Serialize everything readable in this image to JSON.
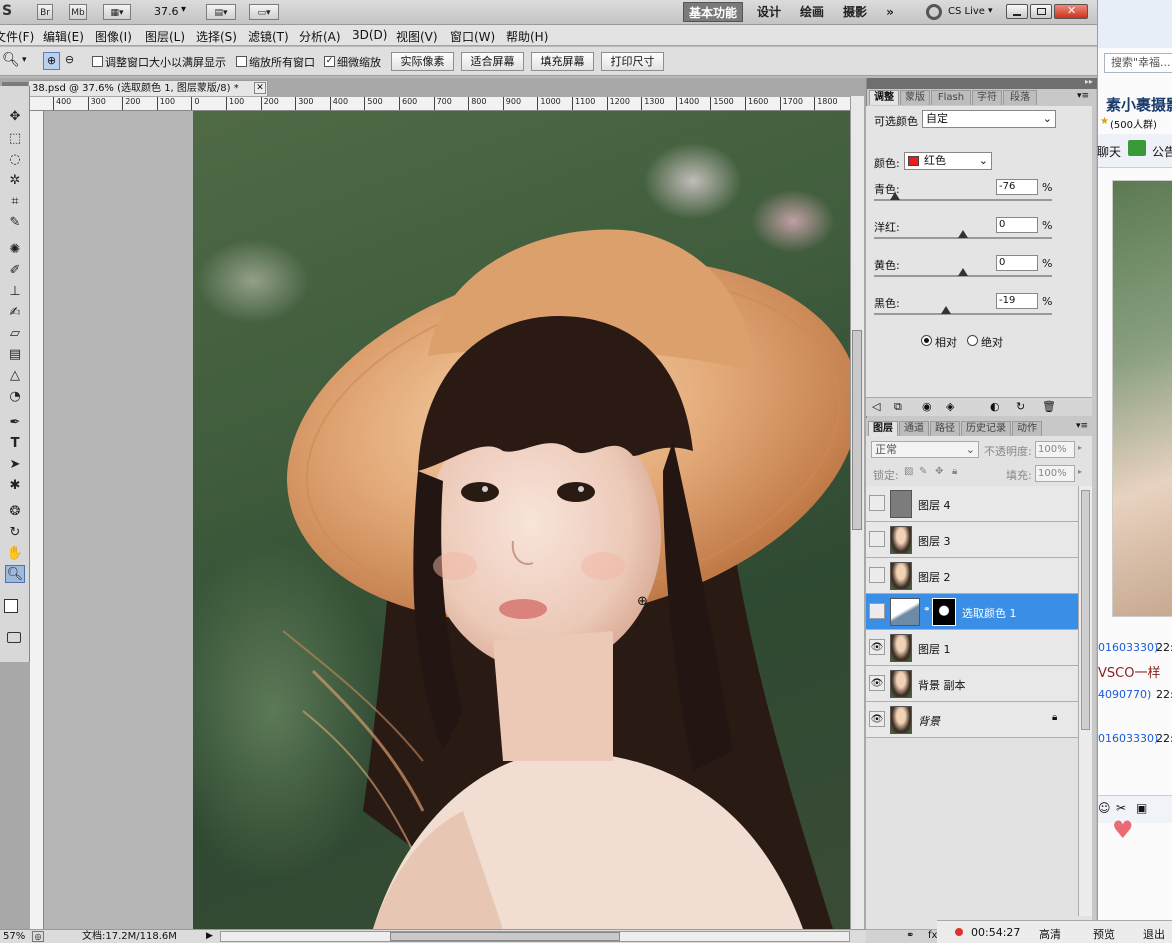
{
  "appbar": {
    "br": "Br",
    "mb": "Mb",
    "zoom": "37.6",
    "workspaces": [
      "基本功能",
      "设计",
      "绘画",
      "摄影"
    ],
    "more": "»",
    "cslive": "CS Live"
  },
  "menu": [
    "文件(F)",
    "编辑(E)",
    "图像(I)",
    "图层(L)",
    "选择(S)",
    "滤镜(T)",
    "分析(A)",
    "3D(D)",
    "视图(V)",
    "窗口(W)",
    "帮助(H)"
  ],
  "options": {
    "fit_window": "调整窗口大小以满屏显示",
    "zoom_all": "缩放所有窗口",
    "scrubby": "细微缩放",
    "buttons": [
      "实际像素",
      "适合屏幕",
      "填充屏幕",
      "打印尺寸"
    ]
  },
  "document": {
    "tab_title": "38.psd @ 37.6% (选取颜色 1, 图层蒙版/8) *",
    "ruler_ticks": [
      "400",
      "300",
      "200",
      "100",
      "0",
      "100",
      "200",
      "300",
      "400",
      "500",
      "600",
      "700",
      "800",
      "900",
      "1000",
      "1100",
      "1200",
      "1300",
      "1400",
      "1500",
      "1600",
      "1700",
      "1800"
    ]
  },
  "status": {
    "zoom": "57%",
    "doc": "文档:17.2M/118.6M"
  },
  "adjustments": {
    "tabs": [
      "调整",
      "蒙版",
      "Flash",
      "字符",
      "段落"
    ],
    "title": "可选颜色",
    "preset": "自定",
    "color_label": "颜色:",
    "color_value": "红色",
    "color_swatch": "#ee1c1c",
    "rows": [
      {
        "label": "青色:",
        "value": "-76",
        "pct": "%",
        "pos": -76
      },
      {
        "label": "洋红:",
        "value": "0",
        "pct": "%",
        "pos": 0
      },
      {
        "label": "黄色:",
        "value": "0",
        "pct": "%",
        "pos": 0
      },
      {
        "label": "黑色:",
        "value": "-19",
        "pct": "%",
        "pos": -19
      }
    ],
    "relative": "相对",
    "absolute": "绝对"
  },
  "layers": {
    "tabs": [
      "图层",
      "通道",
      "路径",
      "历史记录",
      "动作"
    ],
    "blend": "正常",
    "opacity_label": "不透明度:",
    "opacity": "100%",
    "lock_label": "锁定:",
    "fill_label": "填充:",
    "fill": "100%",
    "items": [
      {
        "name": "图层 4",
        "visible": false,
        "selected": false
      },
      {
        "name": "图层 3",
        "visible": false,
        "selected": false
      },
      {
        "name": "图层 2",
        "visible": false,
        "selected": false
      },
      {
        "name": "选取颜色 1",
        "visible": false,
        "selected": true
      },
      {
        "name": "图层 1",
        "visible": true,
        "selected": false
      },
      {
        "name": "背景 副本",
        "visible": true,
        "selected": false
      },
      {
        "name": "背景",
        "visible": true,
        "selected": false
      }
    ]
  },
  "chat": {
    "search_placeholder": "搜索\"幸福...",
    "title": "素小裹摄影",
    "members": "(500人群)",
    "tab_chat": "聊天",
    "tab_notice": "公告",
    "msg1": "01603330)",
    "time1": "22:",
    "msg2": "VSCO一样",
    "msg3": "4090770)",
    "time3": "22:",
    "msg4": "01603330)",
    "time4": "22:"
  },
  "recording": {
    "time": "00:54:27",
    "quality": "高清",
    "preview": "预览",
    "exit": "退出"
  }
}
